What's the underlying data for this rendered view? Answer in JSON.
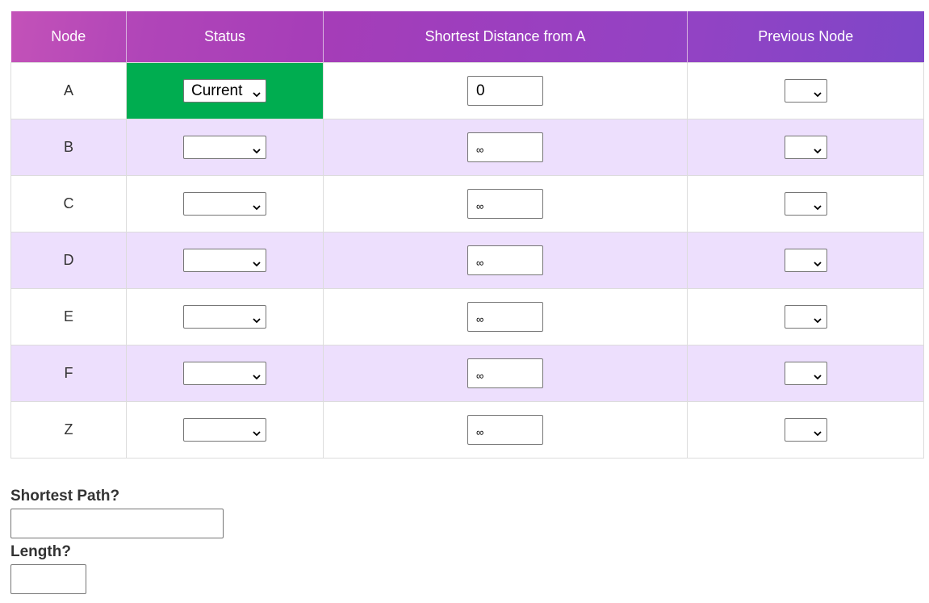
{
  "table": {
    "headers": {
      "node": "Node",
      "status": "Status",
      "distance": "Shortest Distance from A",
      "previous": "Previous Node"
    },
    "rows": [
      {
        "node": "A",
        "status": "Current",
        "distance": "0",
        "previous": ""
      },
      {
        "node": "B",
        "status": "",
        "distance": "∞",
        "previous": ""
      },
      {
        "node": "C",
        "status": "",
        "distance": "∞",
        "previous": ""
      },
      {
        "node": "D",
        "status": "",
        "distance": "∞",
        "previous": ""
      },
      {
        "node": "E",
        "status": "",
        "distance": "∞",
        "previous": ""
      },
      {
        "node": "F",
        "status": "",
        "distance": "∞",
        "previous": ""
      },
      {
        "node": "Z",
        "status": "",
        "distance": "∞",
        "previous": ""
      }
    ]
  },
  "questions": {
    "shortest_path_label": "Shortest Path?",
    "shortest_path_value": "",
    "length_label": "Length?",
    "length_value": ""
  },
  "colors": {
    "header_gradient_start": "#c352b8",
    "header_gradient_end": "#7e46c8",
    "current_status": "#00ad50",
    "alt_row": "#eddffd"
  },
  "icons": {
    "dropdown": "chevron-down-icon"
  }
}
